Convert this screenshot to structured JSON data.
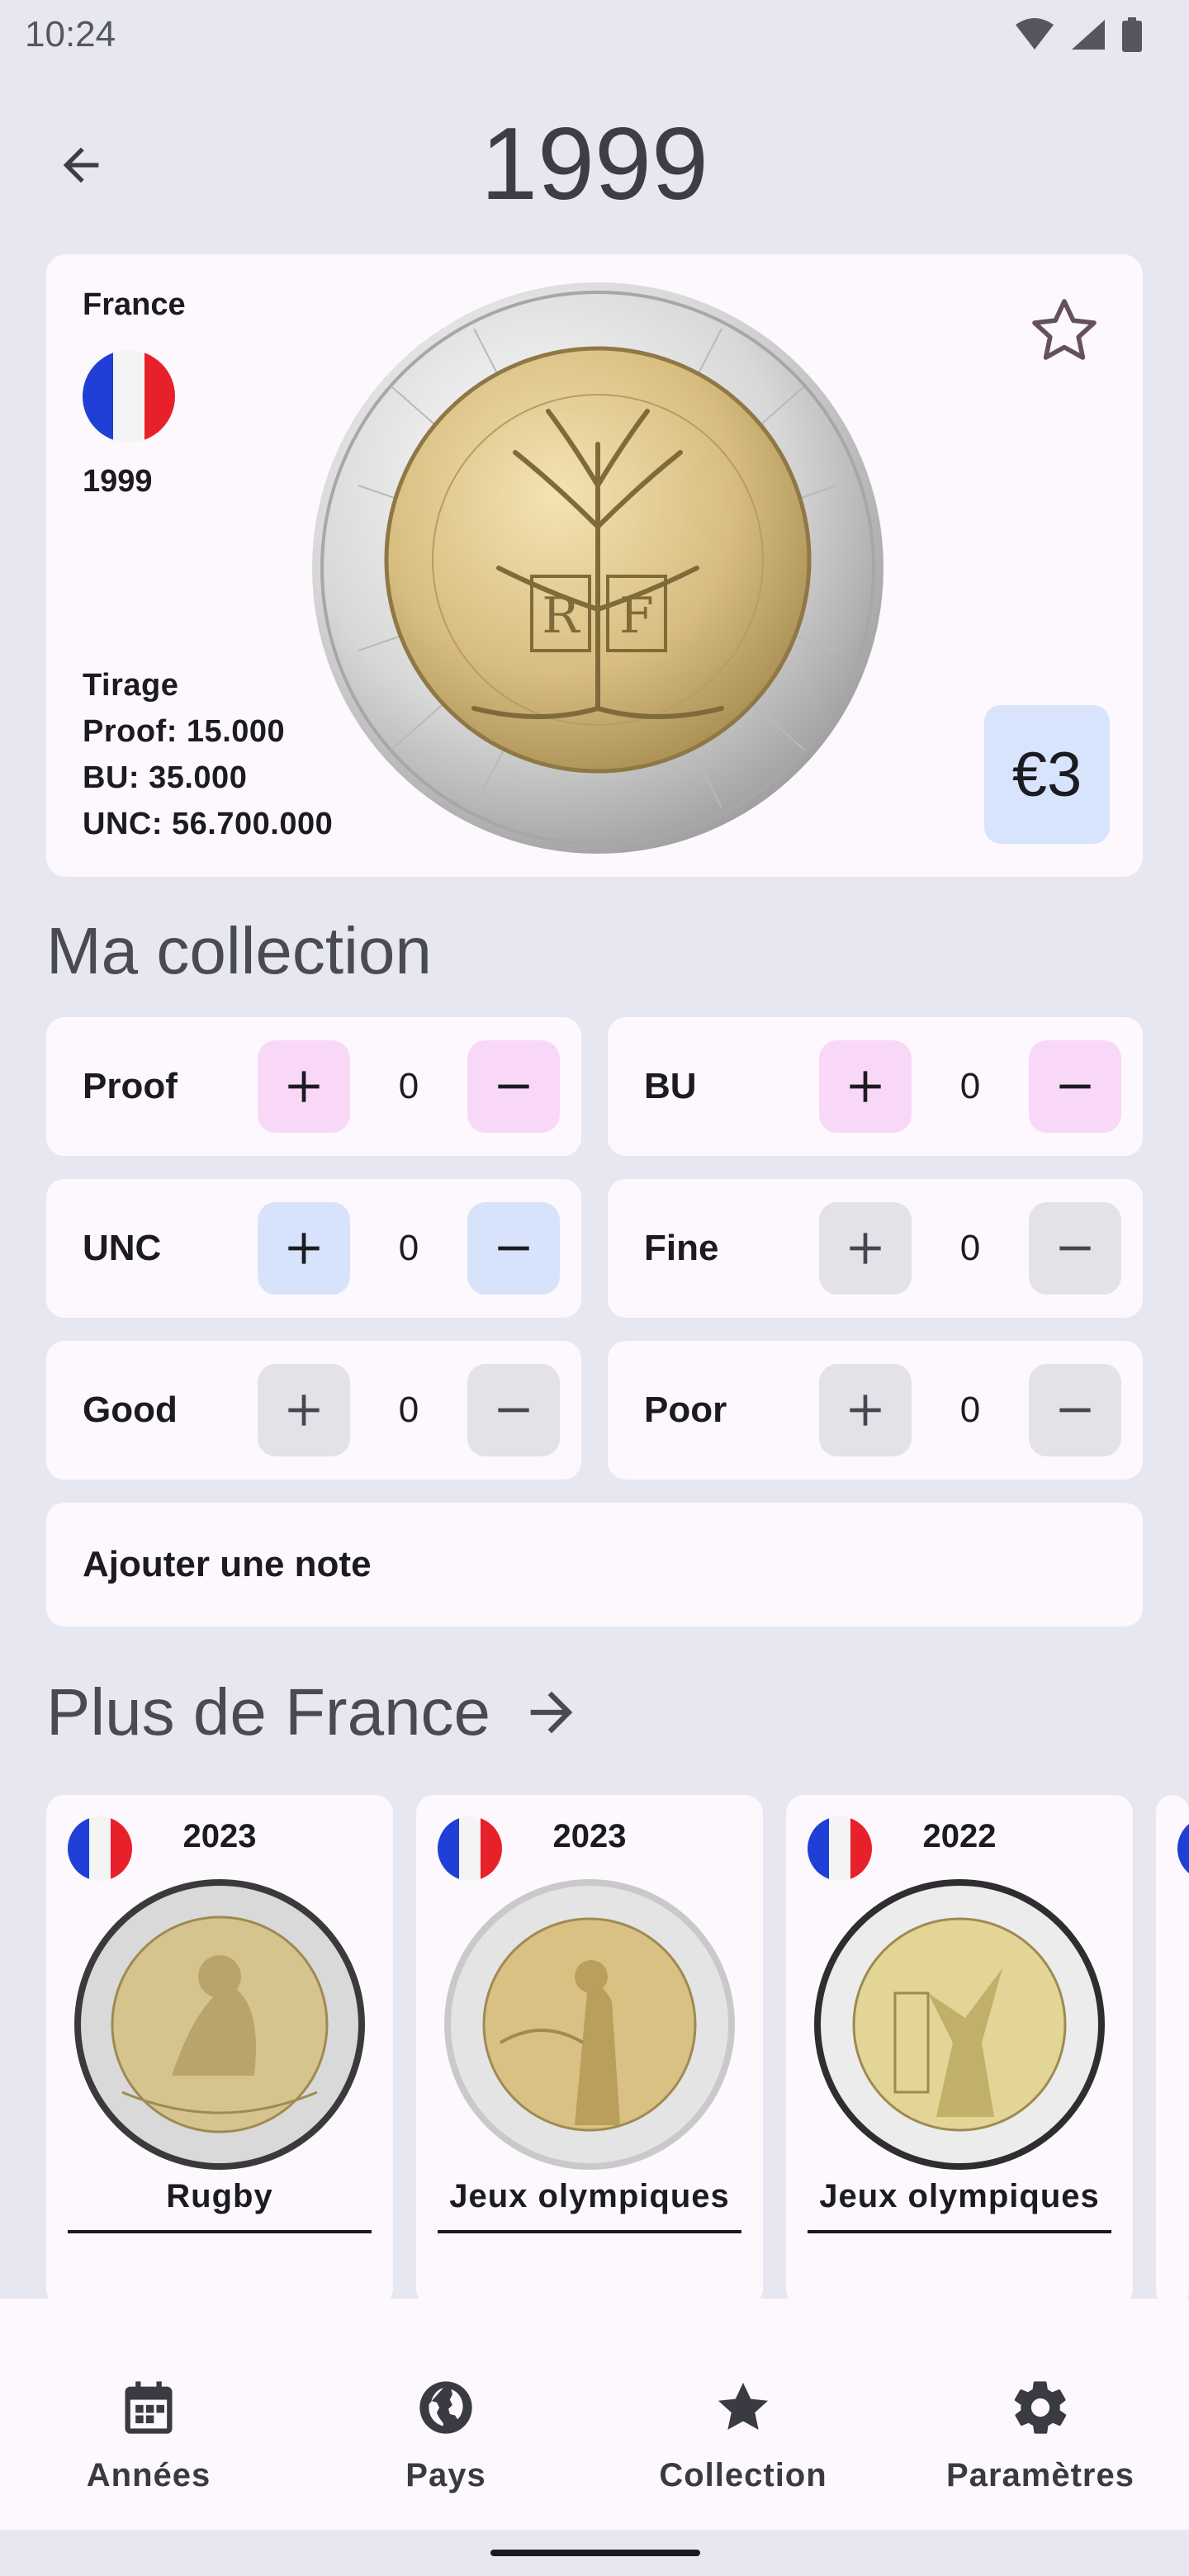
{
  "status_bar": {
    "time": "10:24"
  },
  "header": {
    "title": "1999"
  },
  "coin": {
    "country": "France",
    "year": "1999",
    "mintage_label": "Tirage",
    "mintage_lines": [
      "Proof: 15.000",
      "BU: 35.000",
      "UNC: 56.700.000"
    ],
    "value": "€3"
  },
  "collection": {
    "title": "Ma collection",
    "counters": [
      {
        "label": "Proof",
        "value": "0"
      },
      {
        "label": "BU",
        "value": "0"
      },
      {
        "label": "UNC",
        "value": "0"
      },
      {
        "label": "Fine",
        "value": "0"
      },
      {
        "label": "Good",
        "value": "0"
      },
      {
        "label": "Poor",
        "value": "0"
      }
    ],
    "note_label": "Ajouter une note"
  },
  "more": {
    "title": "Plus de France",
    "cards": [
      {
        "year": "2023",
        "name": "Rugby"
      },
      {
        "year": "2023",
        "name": "Jeux olympiques"
      },
      {
        "year": "2022",
        "name": "Jeux olympiques"
      }
    ]
  },
  "nav": {
    "items": [
      {
        "label": "Années",
        "icon": "calendar-icon"
      },
      {
        "label": "Pays",
        "icon": "globe-icon"
      },
      {
        "label": "Collection",
        "icon": "star-icon"
      },
      {
        "label": "Paramètres",
        "icon": "gear-icon"
      }
    ]
  },
  "colors": {
    "background": "#e6e7f0",
    "card": "#fdf8fd",
    "pink_button": "#f9d8f7",
    "blue_button": "#d6e3fb",
    "gray_button": "#e3e2e8",
    "value_badge": "#d7e4fc"
  }
}
